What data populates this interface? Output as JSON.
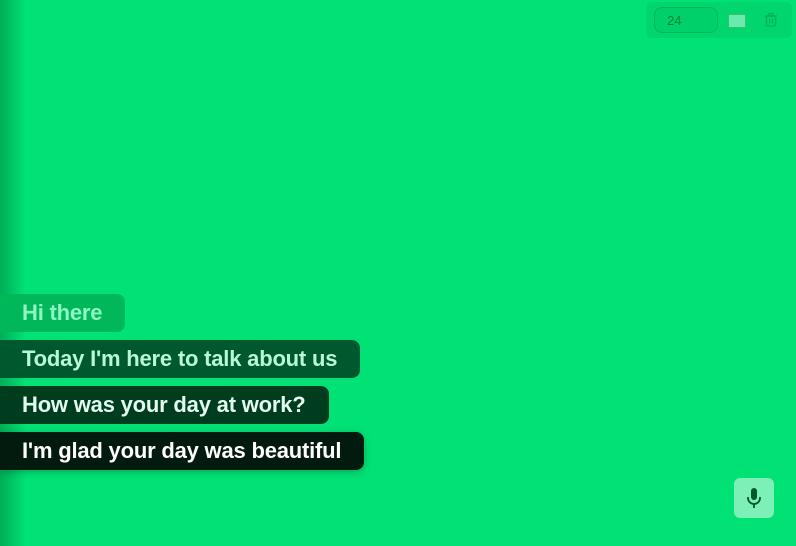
{
  "toolbar": {
    "font_size_value": "24",
    "color_swatch": "#69ebac",
    "delete_icon": "trash-icon"
  },
  "messages": [
    {
      "text": "Hi there"
    },
    {
      "text": "Today I'm here to talk about us"
    },
    {
      "text": "How was your day at work?"
    },
    {
      "text": "I'm glad your day was beautiful"
    }
  ],
  "mic": {
    "icon": "microphone-icon"
  },
  "colors": {
    "background": "#00e276",
    "bubble_1": "#00b85a",
    "bubble_2": "#00592e",
    "bubble_3": "#003d1f",
    "bubble_4": "#031a0e",
    "mic_button": "#7cf0b6"
  }
}
